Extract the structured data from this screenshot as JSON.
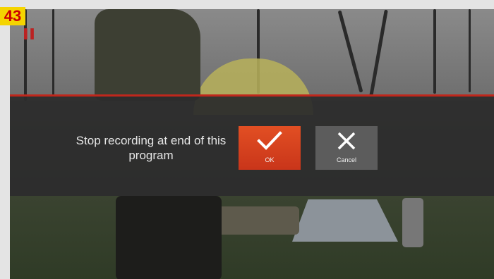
{
  "badge": {
    "number": "43"
  },
  "dialog": {
    "message": "Stop recording at end of this program",
    "ok_label": "OK",
    "cancel_label": "Cancel"
  },
  "icons": {
    "ok": "checkmark-icon",
    "cancel": "close-icon"
  },
  "colors": {
    "accent": "#c0271c",
    "ok_button": "#d9431f",
    "cancel_button": "#5c5c5c",
    "badge_bg": "#f5d400",
    "badge_text": "#cc0000"
  }
}
